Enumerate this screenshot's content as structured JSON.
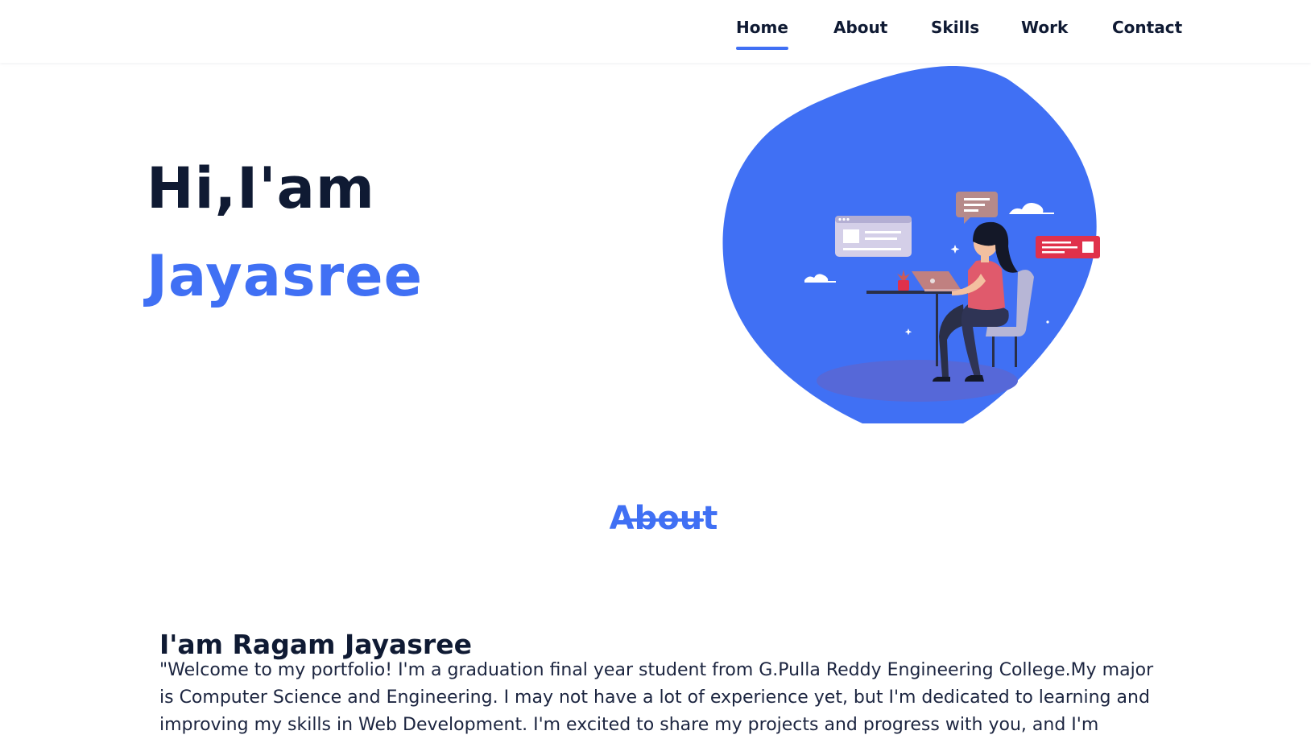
{
  "nav": {
    "items": [
      {
        "label": "Home",
        "active": true
      },
      {
        "label": "About",
        "active": false
      },
      {
        "label": "Skills",
        "active": false
      },
      {
        "label": "Work",
        "active": false
      },
      {
        "label": "Contact",
        "active": false
      }
    ]
  },
  "hero": {
    "greeting": "Hi,I'am",
    "name": "Jayasree",
    "illustration": "woman-working-on-laptop-illustration"
  },
  "about": {
    "title": "About",
    "heading": "I'am Ragam Jayasree",
    "text": "\"Welcome to my portfolio! I'm a graduation final year student from G.Pulla Reddy Engineering College.My major is Computer Science and Engineering. I may not have a lot of experience yet, but I'm dedicated to learning and improving my skills in Web Development. I'm excited to share my projects and progress with you, and I'm"
  },
  "colors": {
    "accent": "#4070f4",
    "dark": "#0f1a33",
    "blob": "#4070f4"
  }
}
